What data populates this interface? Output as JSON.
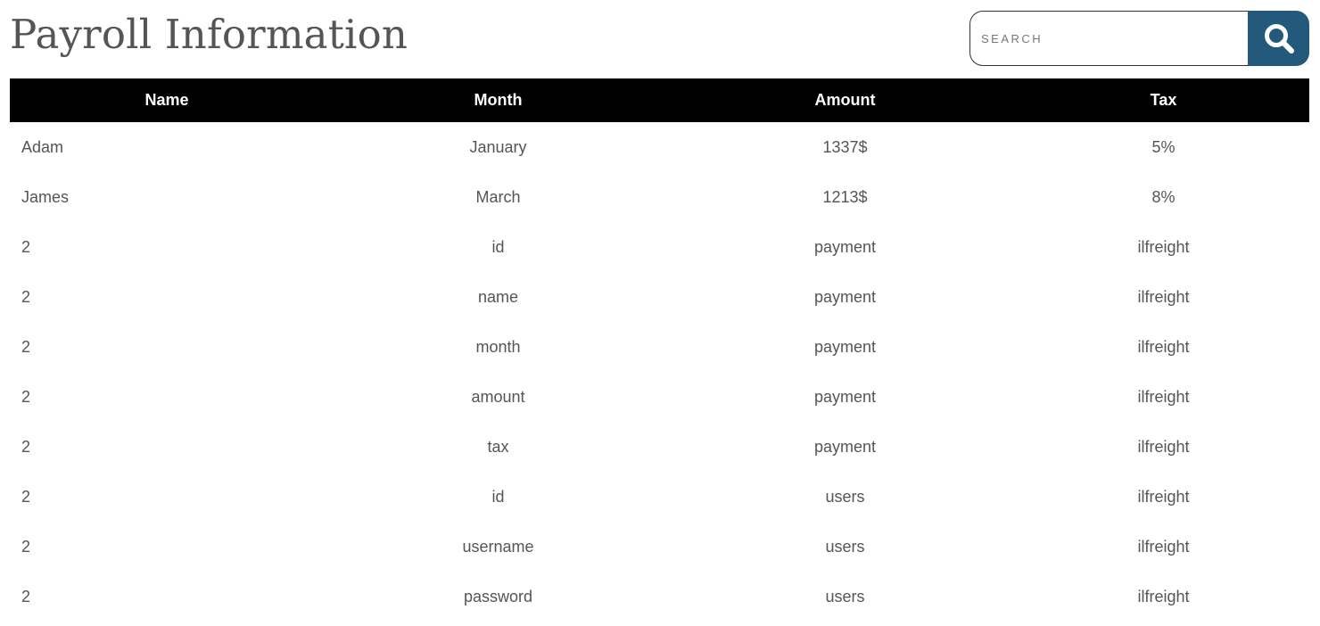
{
  "page": {
    "title": "Payroll Information"
  },
  "search": {
    "placeholder": "SEARCH",
    "button_icon": "search-icon",
    "button_color": "#235a7b"
  },
  "table": {
    "header_color": "#000000",
    "headers": [
      "Name",
      "Month",
      "Amount",
      "Tax"
    ],
    "rows": [
      [
        "Adam",
        "January",
        "1337$",
        "5%"
      ],
      [
        "James",
        "March",
        "1213$",
        "8%"
      ],
      [
        "2",
        "id",
        "payment",
        "ilfreight"
      ],
      [
        "2",
        "name",
        "payment",
        "ilfreight"
      ],
      [
        "2",
        "month",
        "payment",
        "ilfreight"
      ],
      [
        "2",
        "amount",
        "payment",
        "ilfreight"
      ],
      [
        "2",
        "tax",
        "payment",
        "ilfreight"
      ],
      [
        "2",
        "id",
        "users",
        "ilfreight"
      ],
      [
        "2",
        "username",
        "users",
        "ilfreight"
      ],
      [
        "2",
        "password",
        "users",
        "ilfreight"
      ]
    ]
  }
}
